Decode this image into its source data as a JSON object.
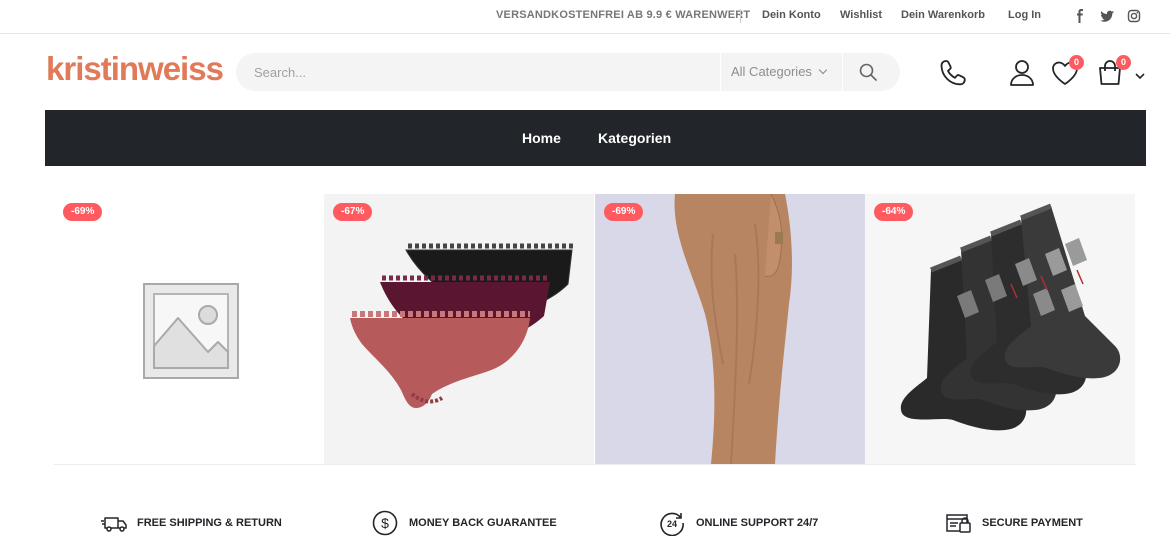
{
  "topbar": {
    "promo": "VERSANDKOSTENFREI AB 9.9 € WARENWERT",
    "links": [
      "Dein Konto",
      "Wishlist",
      "Dein Warenkorb",
      "Log In"
    ],
    "social": [
      "facebook-icon",
      "twitter-icon",
      "instagram-icon"
    ]
  },
  "header": {
    "logo": "kristinweiss",
    "search": {
      "placeholder": "Search...",
      "category": "All Categories"
    },
    "wishlist_count": "0",
    "cart_count": "0"
  },
  "nav": {
    "items": [
      "Home",
      "Kategorien"
    ]
  },
  "products": [
    {
      "discount": "-69%",
      "image": "placeholder-image"
    },
    {
      "discount": "-67%",
      "image": "briefs-set"
    },
    {
      "discount": "-69%",
      "image": "knit-pants"
    },
    {
      "discount": "-64%",
      "image": "argyle-socks"
    }
  ],
  "features": [
    {
      "label": "FREE SHIPPING & RETURN",
      "icon": "truck-icon"
    },
    {
      "label": "MONEY BACK GUARANTEE",
      "icon": "dollar-icon"
    },
    {
      "label": "ONLINE SUPPORT 24/7",
      "icon": "support-24-icon"
    },
    {
      "label": "SECURE PAYMENT",
      "icon": "payment-icon"
    }
  ],
  "colors": {
    "brand": "#e07a58",
    "nav_bg": "#222529",
    "sale_badge": "#ff5a5f"
  }
}
